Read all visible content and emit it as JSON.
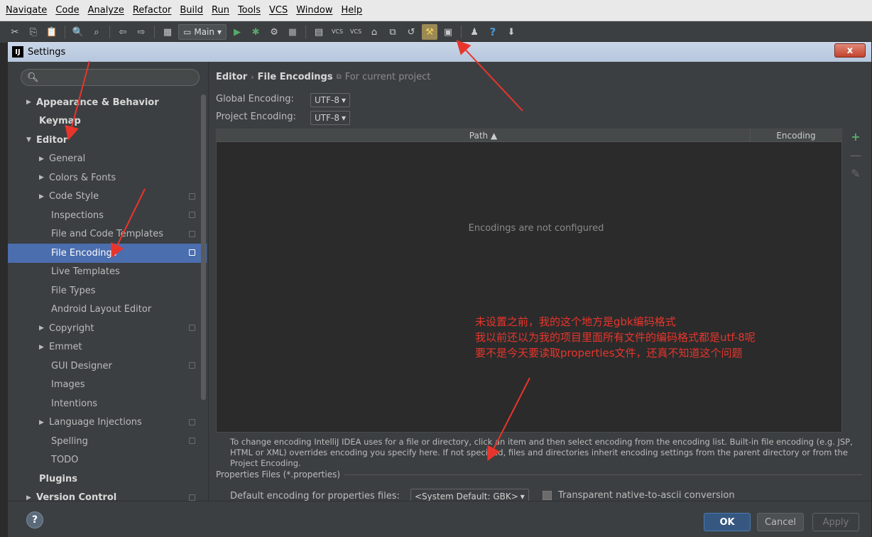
{
  "menubar": {
    "items": [
      "Navigate",
      "Code",
      "Analyze",
      "Refactor",
      "Build",
      "Run",
      "Tools",
      "VCS",
      "Window",
      "Help"
    ]
  },
  "toolbar": {
    "run_config": "Main",
    "icons": [
      "cut-icon",
      "copy-icon",
      "paste-icon",
      "find-icon",
      "replace-icon",
      "back-icon",
      "forward-icon",
      "make-icon",
      "run-icon",
      "debug-icon",
      "coverage-icon",
      "stop-icon",
      "vcs-update-icon",
      "vcs-commit-icon",
      "settings-icon",
      "project-structure-icon",
      "help-icon",
      "sdk-icon"
    ],
    "vcs_label": "VCS"
  },
  "dialog": {
    "title": "Settings",
    "app_icon": "IJ",
    "close_label": "x"
  },
  "sidebar": {
    "search_value": "",
    "items": [
      {
        "label": "Appearance & Behavior",
        "level": 0,
        "arrow": "▶",
        "bold": true
      },
      {
        "label": "Keymap",
        "level": 0,
        "arrow": "",
        "bold": true
      },
      {
        "label": "Editor",
        "level": 0,
        "arrow": "▼",
        "bold": true
      },
      {
        "label": "General",
        "level": 1,
        "arrow": "▶"
      },
      {
        "label": "Colors & Fonts",
        "level": 1,
        "arrow": "▶"
      },
      {
        "label": "Code Style",
        "level": 1,
        "arrow": "▶",
        "project": true
      },
      {
        "label": "Inspections",
        "level": 1,
        "arrow": "",
        "project": true
      },
      {
        "label": "File and Code Templates",
        "level": 1,
        "arrow": "",
        "project": true
      },
      {
        "label": "File Encodings",
        "level": 1,
        "arrow": "",
        "project": true,
        "selected": true
      },
      {
        "label": "Live Templates",
        "level": 1,
        "arrow": ""
      },
      {
        "label": "File Types",
        "level": 1,
        "arrow": ""
      },
      {
        "label": "Android Layout Editor",
        "level": 1,
        "arrow": ""
      },
      {
        "label": "Copyright",
        "level": 1,
        "arrow": "▶",
        "project": true
      },
      {
        "label": "Emmet",
        "level": 1,
        "arrow": "▶"
      },
      {
        "label": "GUI Designer",
        "level": 1,
        "arrow": "",
        "project": true
      },
      {
        "label": "Images",
        "level": 1,
        "arrow": ""
      },
      {
        "label": "Intentions",
        "level": 1,
        "arrow": ""
      },
      {
        "label": "Language Injections",
        "level": 1,
        "arrow": "▶",
        "project": true
      },
      {
        "label": "Spelling",
        "level": 1,
        "arrow": "",
        "project": true
      },
      {
        "label": "TODO",
        "level": 1,
        "arrow": ""
      },
      {
        "label": "Plugins",
        "level": 0,
        "arrow": "",
        "bold": true
      },
      {
        "label": "Version Control",
        "level": 0,
        "arrow": "▶",
        "bold": true,
        "project": true
      }
    ]
  },
  "content": {
    "breadcrumb": {
      "parent": "Editor",
      "sep": "›",
      "current": "File Encodings",
      "note": "For current project"
    },
    "global_encoding": {
      "label": "Global Encoding:",
      "value": "UTF-8"
    },
    "project_encoding": {
      "label": "Project Encoding:",
      "value": "UTF-8"
    },
    "table": {
      "columns": [
        "Path ▲",
        "Encoding"
      ],
      "empty_text": "Encodings are not configured"
    },
    "annotation": [
      "未设置之前，我的这个地方是gbk编码格式",
      "我以前还以为我的项目里面所有文件的编码格式都是utf-8呢",
      "要不是今天要读取properties文件，还真不知道这个问题"
    ],
    "help_text": "To change encoding IntelliJ IDEA uses for a file or directory, click an item and then select encoding from the encoding list. Built-in file encoding (e.g. JSP, HTML or XML) overrides encoding you specify here. If not specified, files and directories inherit encoding settings from the parent directory or from the Project Encoding.",
    "properties": {
      "section_title": "Properties Files (*.properties)",
      "default_label": "Default encoding for properties files:",
      "default_value": "<System Default: GBK>",
      "transparent_label": "Transparent native-to-ascii conversion"
    }
  },
  "buttons": {
    "help": "?",
    "ok": "OK",
    "cancel": "Cancel",
    "apply": "Apply"
  },
  "colors": {
    "selection": "#4b6eaf",
    "annotation": "#e8352c",
    "add": "#59a869"
  }
}
